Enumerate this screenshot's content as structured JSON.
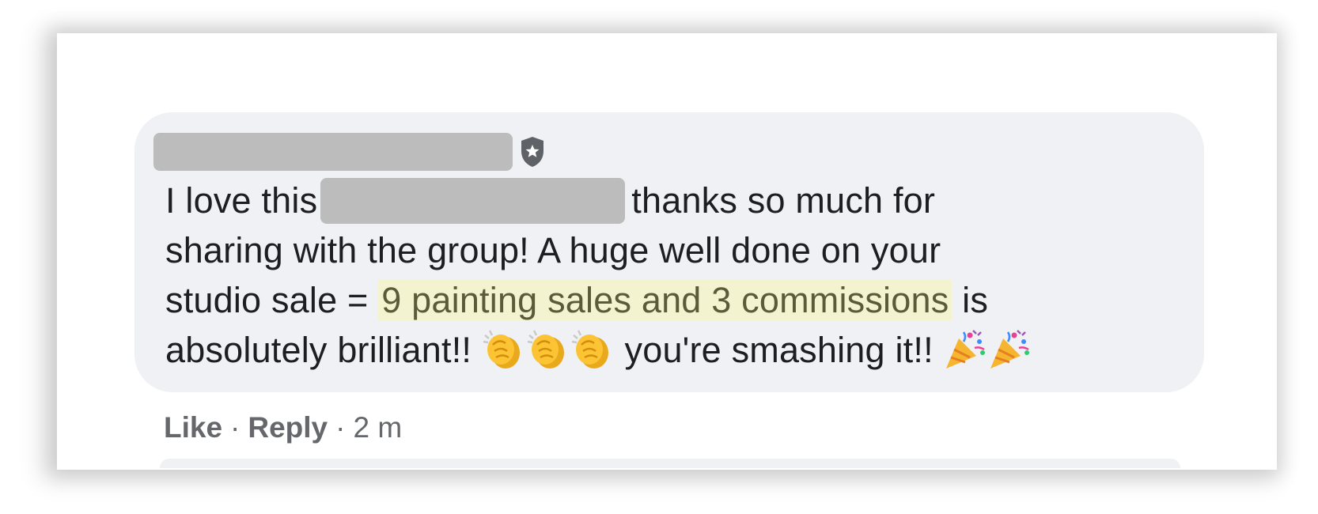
{
  "comment": {
    "author_badge_icon": "shield-star-icon",
    "text": {
      "line1_start": "I love this",
      "line1_end": "thanks so much for",
      "line2": "sharing with the group! A huge well done on your",
      "line3_start": "studio sale =",
      "line3_highlight": "9 painting sales and 3 commissions",
      "line3_end": "is",
      "line4_start": "absolutely brilliant!!",
      "line4_end": "you're smashing it!!"
    },
    "emojis": {
      "clap": "clapping-hands-icon",
      "party": "party-popper-icon"
    }
  },
  "actions": {
    "like_label": "Like",
    "separator": "·",
    "reply_label": "Reply",
    "timestamp": "2 m"
  },
  "colors": {
    "bubble_bg": "#eff1f4",
    "highlight_bg": "#f4f3cf",
    "redaction": "#bcbcbc",
    "action_text": "#65676b"
  }
}
